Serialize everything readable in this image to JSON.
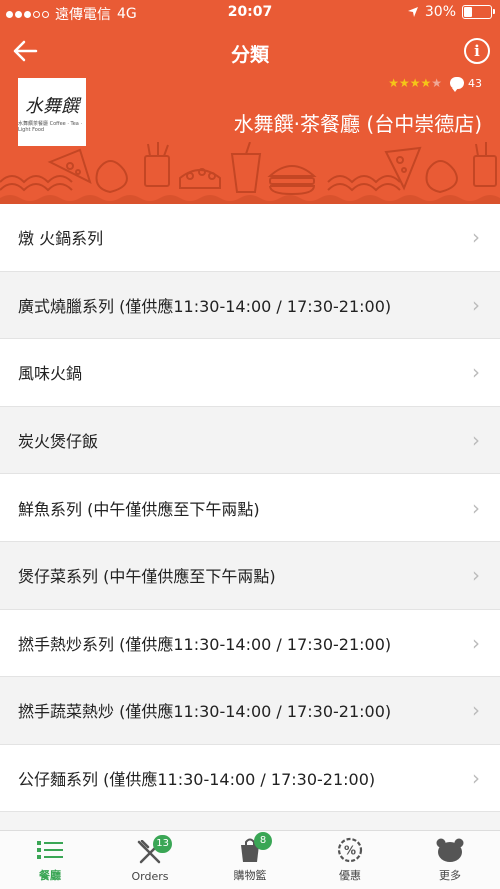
{
  "status_bar": {
    "carrier": "遠傳電信",
    "network": "4G",
    "time": "20:07",
    "battery": "30%"
  },
  "header": {
    "title": "分類",
    "back_icon": "arrow-left-icon",
    "info_icon": "info-icon",
    "restaurant_name": "水舞饌‧茶餐廳 (台中崇德店)",
    "rating_stars": 4.5,
    "review_count": "43",
    "logo_text": "水舞饌",
    "logo_subtext": "水舞饌茶餐廳 Coffee · Tea · Light Food",
    "accent_color": "#e95b35"
  },
  "categories": [
    {
      "label": "燉 火鍋系列"
    },
    {
      "label": "廣式燒臘系列 (僅供應11:30-14:00 / 17:30-21:00)"
    },
    {
      "label": "風味火鍋"
    },
    {
      "label": "炭火煲仔飯"
    },
    {
      "label": "鮮魚系列 (中午僅供應至下午兩點)"
    },
    {
      "label": "煲仔菜系列 (中午僅供應至下午兩點)"
    },
    {
      "label": "撚手熱炒系列 (僅供應11:30-14:00 / 17:30-21:00)"
    },
    {
      "label": "撚手蔬菜熱炒 (僅供應11:30-14:00 / 17:30-21:00)"
    },
    {
      "label": "公仔麵系列 (僅供應11:30-14:00 / 17:30-21:00)"
    }
  ],
  "tabs": [
    {
      "label": "餐廳",
      "icon": "list-icon",
      "active": true,
      "badge": ""
    },
    {
      "label": "Orders",
      "icon": "fork-knife-icon",
      "active": false,
      "badge": "13"
    },
    {
      "label": "購物籃",
      "icon": "shopping-bag-icon",
      "active": false,
      "badge": "8"
    },
    {
      "label": "優惠",
      "icon": "percent-badge-icon",
      "active": false,
      "badge": ""
    },
    {
      "label": "更多",
      "icon": "bear-icon",
      "active": false,
      "badge": ""
    }
  ],
  "colors": {
    "accent": "#e95b35",
    "tab_active": "#3aa655",
    "badge": "#3aa655"
  }
}
